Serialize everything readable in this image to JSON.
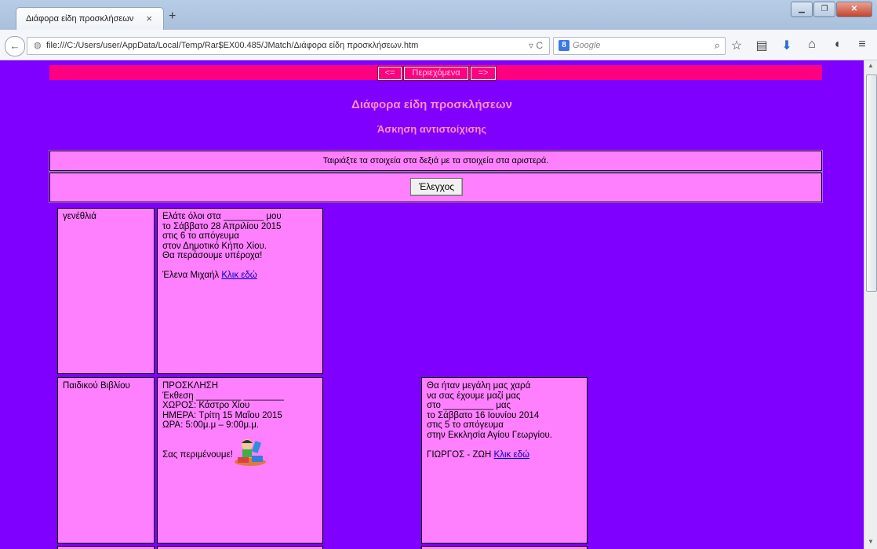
{
  "browser": {
    "tab_title": "Διάφορα είδη προσκλήσεων",
    "tab_close": "×",
    "new_tab": "+",
    "url": "file:///C:/Users/user/AppData/Local/Temp/Rar$EX00.485/JMatch/Διάφορα είδη προσκλήσεων.htm",
    "search_placeholder": "Google"
  },
  "nav": {
    "prev": "<=",
    "contents": "Περιεχόμενα",
    "next": "=>"
  },
  "title": "Διάφορα είδη προσκλήσεων",
  "subtitle": "Άσκηση αντιστοίχισης",
  "instructions": "Ταιριάξτε τα στοιχεία στα δεξιά με τα στοιχεία στα αριστερά.",
  "check_button": "Έλεγχος",
  "rows": [
    {
      "label": "γενέθλιά",
      "text": "Ελάτε όλοι στα ________ μου\nτο Σάββατο 28 Απριλίου 2015\nστις 6 το απόγευμα\nστον Δημοτικό Κήπο Χίου.\nΘα περάσουμε υπέροχα!\n\nΈλενα Μιχαήλ ",
      "link": "Κλικ εδώ"
    },
    {
      "label": "Παιδικού Βιβλίου",
      "text": "ΠΡΟΣΚΛΗΣΗ\nΈκθεση _________ ________\nΧΩΡΟΣ: Κάστρο Χίου\nΗΜΕΡΑ: Τρίτη 15 Μαΐου 2015\nΩΡΑ: 5:00μ.μ – 9:00μ.μ.\n\n\nΣας περιμένουμε!"
    }
  ],
  "right_item": {
    "text": "Θα ήταν μεγάλη μας χαρά\nνα σας έχουμε μαζί μας\nστο __________ μας\nτο Σάββατο 16 Ιουνίου 2014\nστις 5 το απόγευμα\nστην Εκκλησία Αγίου Γεωργίου.\n\nΓΙΩΡΓΟΣ - ΖΩΗ ",
    "link": "Κλικ εδώ"
  },
  "colors": {
    "page_bg": "#7f00ff",
    "nav_strip": "#ff0080",
    "box_bg": "#ff80ff",
    "heading": "#ff8cc6"
  }
}
